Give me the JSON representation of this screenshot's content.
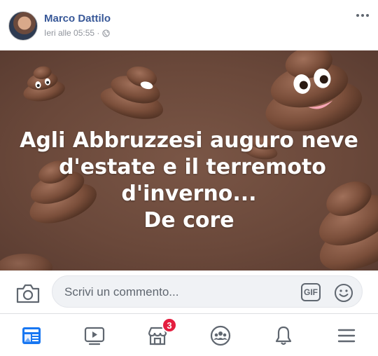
{
  "post": {
    "author": "Marco Dattilo",
    "timestamp": "Ieri alle 05:55 ·",
    "privacy_icon": "globe-icon",
    "image_caption": {
      "line1": "Agli Abbruzzesi auguro neve",
      "line2": "d'estate e il terremoto",
      "line3": "d'inverno...",
      "line4": "De core"
    }
  },
  "comment_bar": {
    "placeholder": "Scrivi un commento...",
    "gif_label": "GIF"
  },
  "bottom_nav": {
    "items": [
      {
        "icon": "news-feed-icon"
      },
      {
        "icon": "watch-icon"
      },
      {
        "icon": "marketplace-icon",
        "badge": "3"
      },
      {
        "icon": "groups-icon"
      },
      {
        "icon": "notifications-icon"
      },
      {
        "icon": "menu-icon"
      }
    ],
    "active_color": "#1877f2"
  },
  "colors": {
    "author_link": "#385898",
    "meta_text": "#90949c",
    "image_background": "#6a483a",
    "badge": "#e41e3f"
  }
}
